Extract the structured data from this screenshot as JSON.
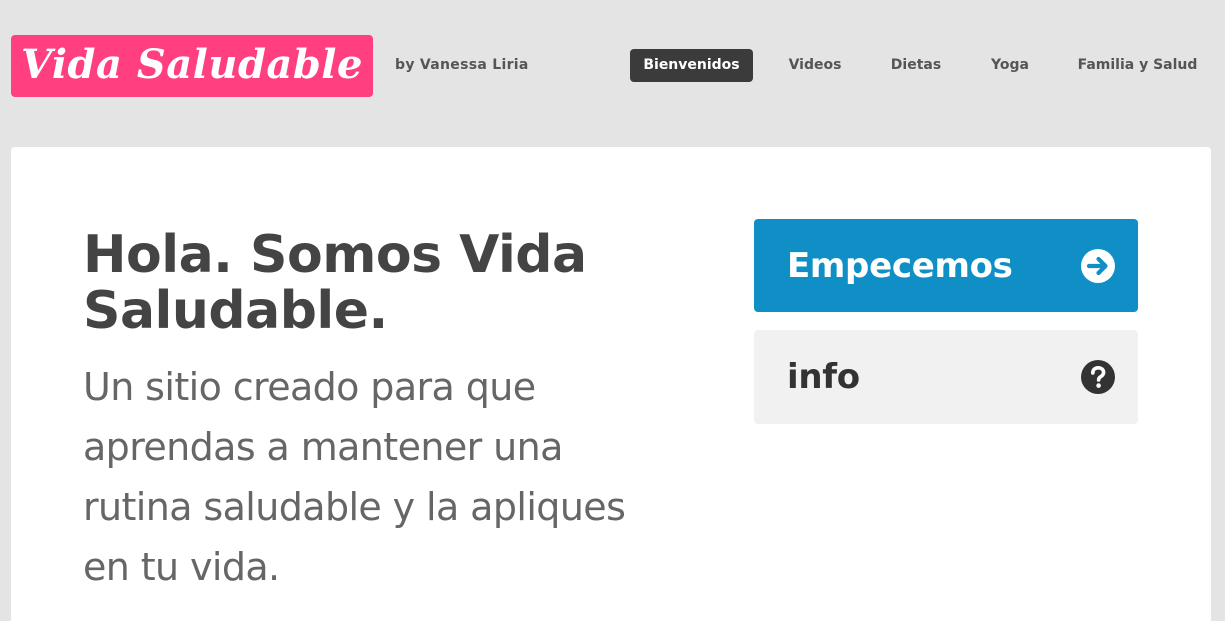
{
  "brand": {
    "logo_text": "Vida Saludable",
    "byline": "by Vanessa Liria",
    "logo_color": "#ff3f7f"
  },
  "nav": {
    "items": [
      {
        "label": "Bienvenidos",
        "active": true
      },
      {
        "label": "Videos",
        "active": false
      },
      {
        "label": "Dietas",
        "active": false
      },
      {
        "label": "Yoga",
        "active": false
      },
      {
        "label": "Familia y Salud",
        "active": false
      }
    ]
  },
  "hero": {
    "title": "Hola. Somos Vida Saludable.",
    "subtitle": "Un sitio creado para que aprendas a mantener una rutina saludable y la apliques en tu vida."
  },
  "actions": {
    "primary": {
      "label": "Empecemos",
      "icon": "arrow-circle-right-icon",
      "color": "#0f8fc6"
    },
    "secondary": {
      "label": "info",
      "icon": "question-circle-icon",
      "color": "#f1f1f1"
    }
  }
}
